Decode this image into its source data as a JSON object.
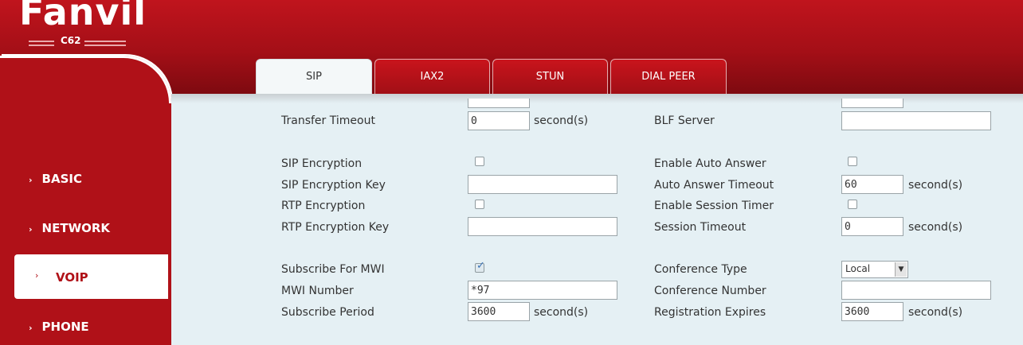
{
  "brand": {
    "name": "Fanvil",
    "model": "C62"
  },
  "tabs": [
    {
      "label": "SIP",
      "active": true
    },
    {
      "label": "IAX2",
      "active": false
    },
    {
      "label": "STUN",
      "active": false
    },
    {
      "label": "DIAL PEER",
      "active": false
    }
  ],
  "sidebar": {
    "items": [
      {
        "label": "BASIC",
        "active": false
      },
      {
        "label": "NETWORK",
        "active": false
      },
      {
        "label": "VOIP",
        "active": true
      },
      {
        "label": "PHONE",
        "active": false
      }
    ],
    "arrow": "›"
  },
  "form": {
    "left": {
      "transfer_timeout": {
        "label": "Transfer Timeout",
        "value": "0",
        "unit": "second(s)"
      },
      "sip_encryption": {
        "label": "SIP Encryption",
        "checked": false
      },
      "sip_encryption_key": {
        "label": "SIP Encryption Key",
        "value": ""
      },
      "rtp_encryption": {
        "label": "RTP Encryption",
        "checked": false
      },
      "rtp_encryption_key": {
        "label": "RTP Encryption Key",
        "value": ""
      },
      "subscribe_mwi": {
        "label": "Subscribe For MWI",
        "checked": true
      },
      "mwi_number": {
        "label": "MWI Number",
        "value": "*97"
      },
      "subscribe_period": {
        "label": "Subscribe Period",
        "value": "3600",
        "unit": "second(s)"
      }
    },
    "right": {
      "blf_server": {
        "label": "BLF Server",
        "value": ""
      },
      "enable_auto_answer": {
        "label": "Enable Auto Answer",
        "checked": false
      },
      "auto_answer_timeout": {
        "label": "Auto Answer Timeout",
        "value": "60",
        "unit": "second(s)"
      },
      "enable_session_timer": {
        "label": "Enable Session Timer",
        "checked": false
      },
      "session_timeout": {
        "label": "Session Timeout",
        "value": "0",
        "unit": "second(s)"
      },
      "conference_type": {
        "label": "Conference Type",
        "value": "Local"
      },
      "conference_number": {
        "label": "Conference Number",
        "value": ""
      },
      "registration_expires": {
        "label": "Registration Expires",
        "value": "3600",
        "unit": "second(s)"
      }
    }
  },
  "colors": {
    "brand_red": "#b01118",
    "content_bg": "#e5f0f4"
  }
}
